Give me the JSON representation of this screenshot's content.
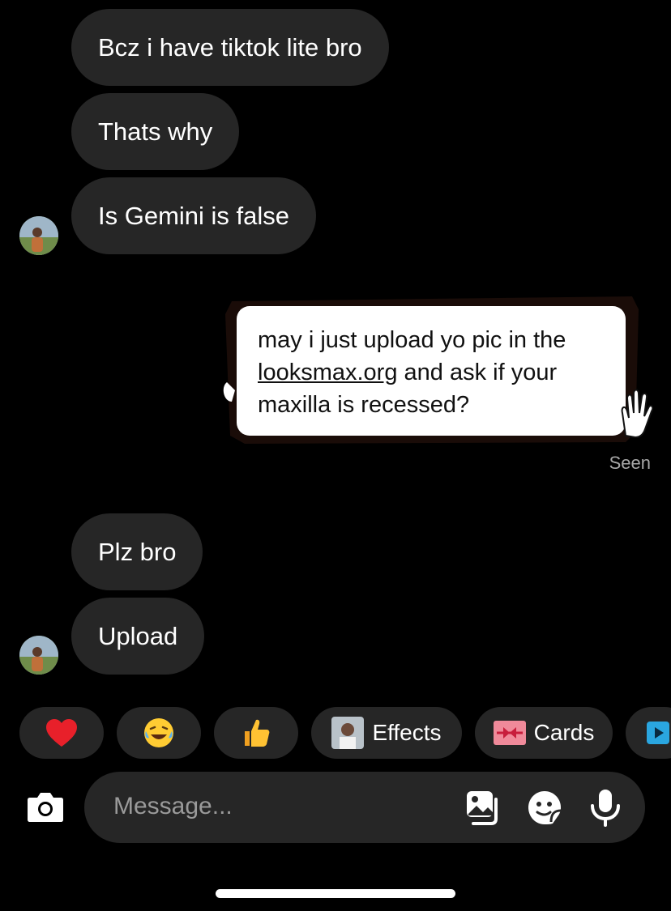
{
  "messages": [
    {
      "text": "Bcz i have tiktok lite bro"
    },
    {
      "text": "Thats why"
    },
    {
      "text": "Is Gemini is false"
    },
    {
      "text": "Plz bro"
    },
    {
      "text": "Upload"
    }
  ],
  "sticker_message": {
    "line1": "may i just upload yo pic in the",
    "link": "looksmax.org",
    "line2_rest": " and ask if your",
    "line3": "maxilla is recessed?"
  },
  "seen_label": "Seen",
  "quick_reactions": [
    {
      "emoji": "❤️",
      "icon": "heart-icon"
    },
    {
      "emoji": "😂",
      "icon": "laughing-emoji-icon"
    },
    {
      "emoji": "👍",
      "icon": "thumbs-up-icon"
    }
  ],
  "chips": {
    "effects_label": "Effects",
    "cards_label": "Cards"
  },
  "composer": {
    "placeholder": "Message..."
  },
  "colors": {
    "background": "#000000",
    "bubble": "#262626",
    "seen": "#a8a8a8",
    "accent_blue": "#3797f0"
  }
}
